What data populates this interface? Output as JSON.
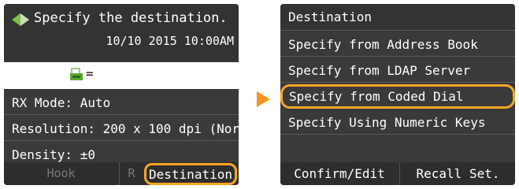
{
  "left_panel": {
    "title": "Specify the destination.",
    "datetime": "10/10 2015 10:00AM",
    "fax_field_text": "=",
    "rx_mode": "RX Mode: Auto",
    "resolution": "Resolution: 200 x 100 dpi (Nor",
    "density": "Density: ±0",
    "buttons": {
      "hook": "Hook",
      "r": "R",
      "destination": "Destination"
    }
  },
  "right_panel": {
    "title": "Destination",
    "items": [
      "Specify from Address Book",
      "Specify from LDAP Server",
      "Specify from Coded Dial",
      "Specify Using Numeric Keys"
    ],
    "buttons": {
      "confirm_edit": "Confirm/Edit",
      "recall_set": "Recall Set."
    }
  },
  "colors": {
    "highlight": "#f5a623",
    "arrow": "#f7941d",
    "panel_bg": "#3a3a3a"
  }
}
